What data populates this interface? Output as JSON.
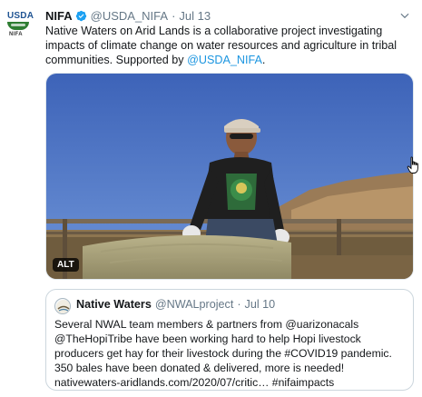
{
  "tweet": {
    "avatar_label": "USDA",
    "avatar_sub": "NIFA",
    "display_name": "NIFA",
    "handle": "@USDA_NIFA",
    "separator": "·",
    "date": "Jul 13",
    "text_main": "Native Waters on Arid Lands is a collaborative project investigating impacts of climate change on water resources and agriculture in tribal communities. Supported by ",
    "text_mention": "@USDA_NIFA",
    "text_end": ".",
    "media_alt_badge": "ALT"
  },
  "quoted_tweet": {
    "display_name": "Native Waters",
    "handle": "@NWALproject",
    "separator": "·",
    "date": "Jul 10",
    "text": "Several NWAL team members & partners from @uarizonacals @TheHopiTribe have been working hard to help Hopi livestock producers get hay for their livestock during the #COVID19 pandemic. 350 bales have been donated & delivered, more is needed! nativewaters-aridlands.com/2020/07/critic… #nifaimpacts"
  },
  "icons": {
    "verified": "verified-badge-icon",
    "more": "chevron-down-icon",
    "cursor": "hand-pointer-cursor-icon"
  },
  "colors": {
    "link": "#1b95e0",
    "muted": "#657786",
    "border": "#ccd6dd"
  }
}
